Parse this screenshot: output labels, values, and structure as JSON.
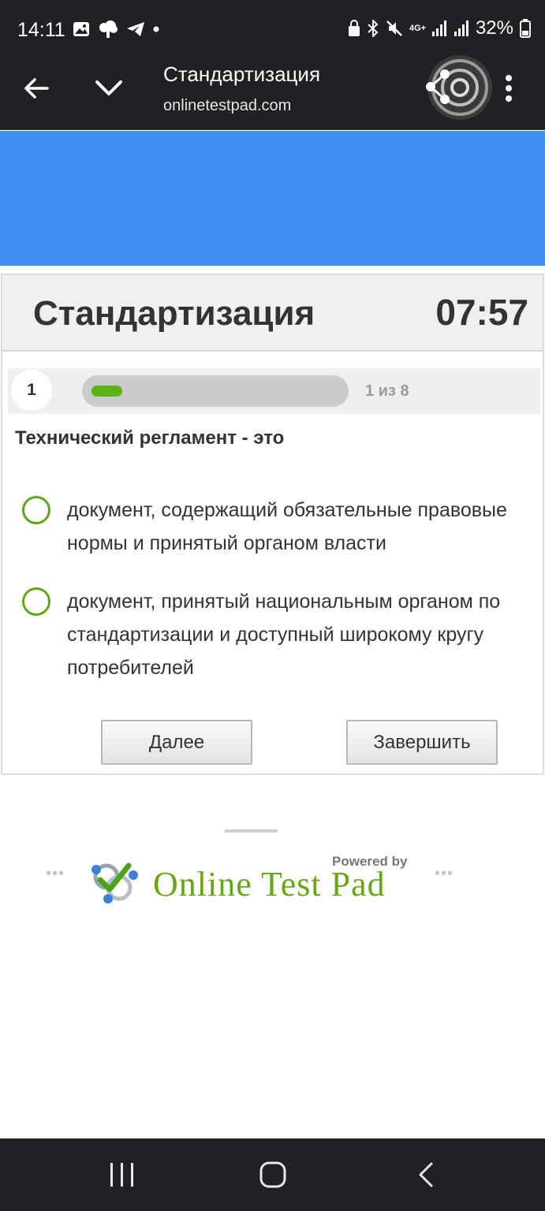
{
  "status_bar": {
    "time": "14:11",
    "battery": "32%",
    "network": "4G+"
  },
  "browser": {
    "page_title": "Стандартизация",
    "url": "onlinetestpad.com"
  },
  "colors": {
    "banner": "#3f8ef2",
    "accent_green": "#5cb318",
    "brand_green": "#67a61b"
  },
  "test": {
    "title": "Стандартизация",
    "timer": "07:57",
    "question_number": "1",
    "progress_label": "1 из 8",
    "progress_fraction": 0.125,
    "question": "Технический регламент - это",
    "options": [
      {
        "text": "документ, содержащий обязательные правовые нормы и принятый органом власти"
      },
      {
        "text": "документ, принятый национальным органом по стандартизации и доступный широкому кругу потребителей"
      }
    ],
    "next_label": "Далее",
    "finish_label": "Завершить"
  },
  "footer": {
    "powered_by": "Powered by",
    "brand": "Online Test Pad"
  }
}
